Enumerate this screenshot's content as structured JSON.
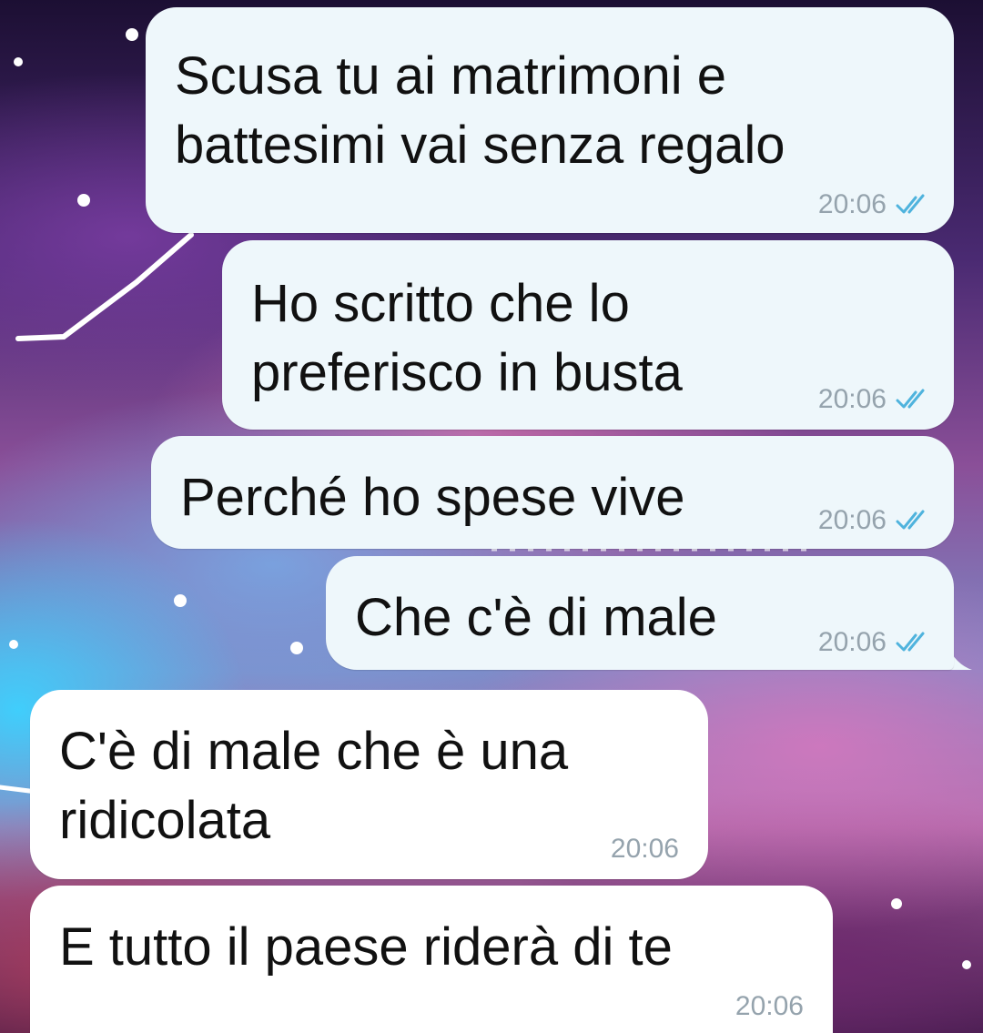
{
  "theme": {
    "outgoing_bubble": "#eef7fb",
    "incoming_bubble": "#ffffff",
    "read_tick_color": "#4fb3dd",
    "timestamp_color": "#95a3ad"
  },
  "messages": [
    {
      "direction": "outgoing",
      "lines": [
        "Scusa tu ai matrimoni e",
        "battesimi vai senza regalo"
      ],
      "time": "20:06",
      "status_icon": "double-check-read-icon"
    },
    {
      "direction": "outgoing",
      "lines": [
        "Ho scritto che lo",
        "preferisco in busta"
      ],
      "time": "20:06",
      "status_icon": "double-check-read-icon"
    },
    {
      "direction": "outgoing",
      "lines": [
        "Perché ho spese vive"
      ],
      "time": "20:06",
      "status_icon": "double-check-read-icon"
    },
    {
      "direction": "outgoing",
      "lines": [
        "Che c'è di male"
      ],
      "time": "20:06",
      "status_icon": "double-check-read-icon"
    },
    {
      "direction": "incoming",
      "lines": [
        "C'è di male che è una",
        "ridicolata"
      ],
      "time": "20:06"
    },
    {
      "direction": "incoming",
      "lines": [
        "E tutto il paese riderà di te"
      ],
      "time": "20:06"
    }
  ]
}
